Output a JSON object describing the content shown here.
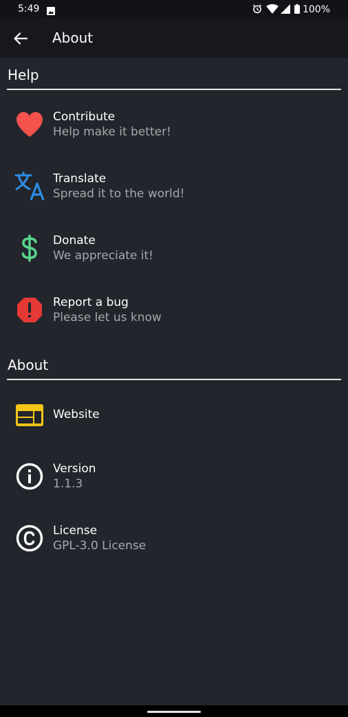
{
  "status_bar": {
    "time": "5:49",
    "battery_text": "100%"
  },
  "toolbar": {
    "title": "About"
  },
  "sections": {
    "help": {
      "title": "Help",
      "items": [
        {
          "title": "Contribute",
          "subtitle": "Help make it better!",
          "icon": "heart-icon",
          "color": "#f4524d"
        },
        {
          "title": "Translate",
          "subtitle": "Spread it to the world!",
          "icon": "translate-icon",
          "color": "#2f8de4"
        },
        {
          "title": "Donate",
          "subtitle": "We appreciate it!",
          "icon": "dollar-icon",
          "color": "#58d68d"
        },
        {
          "title": "Report a bug",
          "subtitle": "Please let us know",
          "icon": "error-octagon-icon",
          "color": "#e53935"
        }
      ]
    },
    "about": {
      "title": "About",
      "items": [
        {
          "title": "Website",
          "icon": "web-icon",
          "color": "#f5c518"
        },
        {
          "title": "Version",
          "subtitle": "1.1.3",
          "icon": "info-icon",
          "color": "#ffffff"
        },
        {
          "title": "License",
          "subtitle": "GPL-3.0 License",
          "icon": "copyright-icon",
          "color": "#ffffff"
        }
      ]
    }
  }
}
